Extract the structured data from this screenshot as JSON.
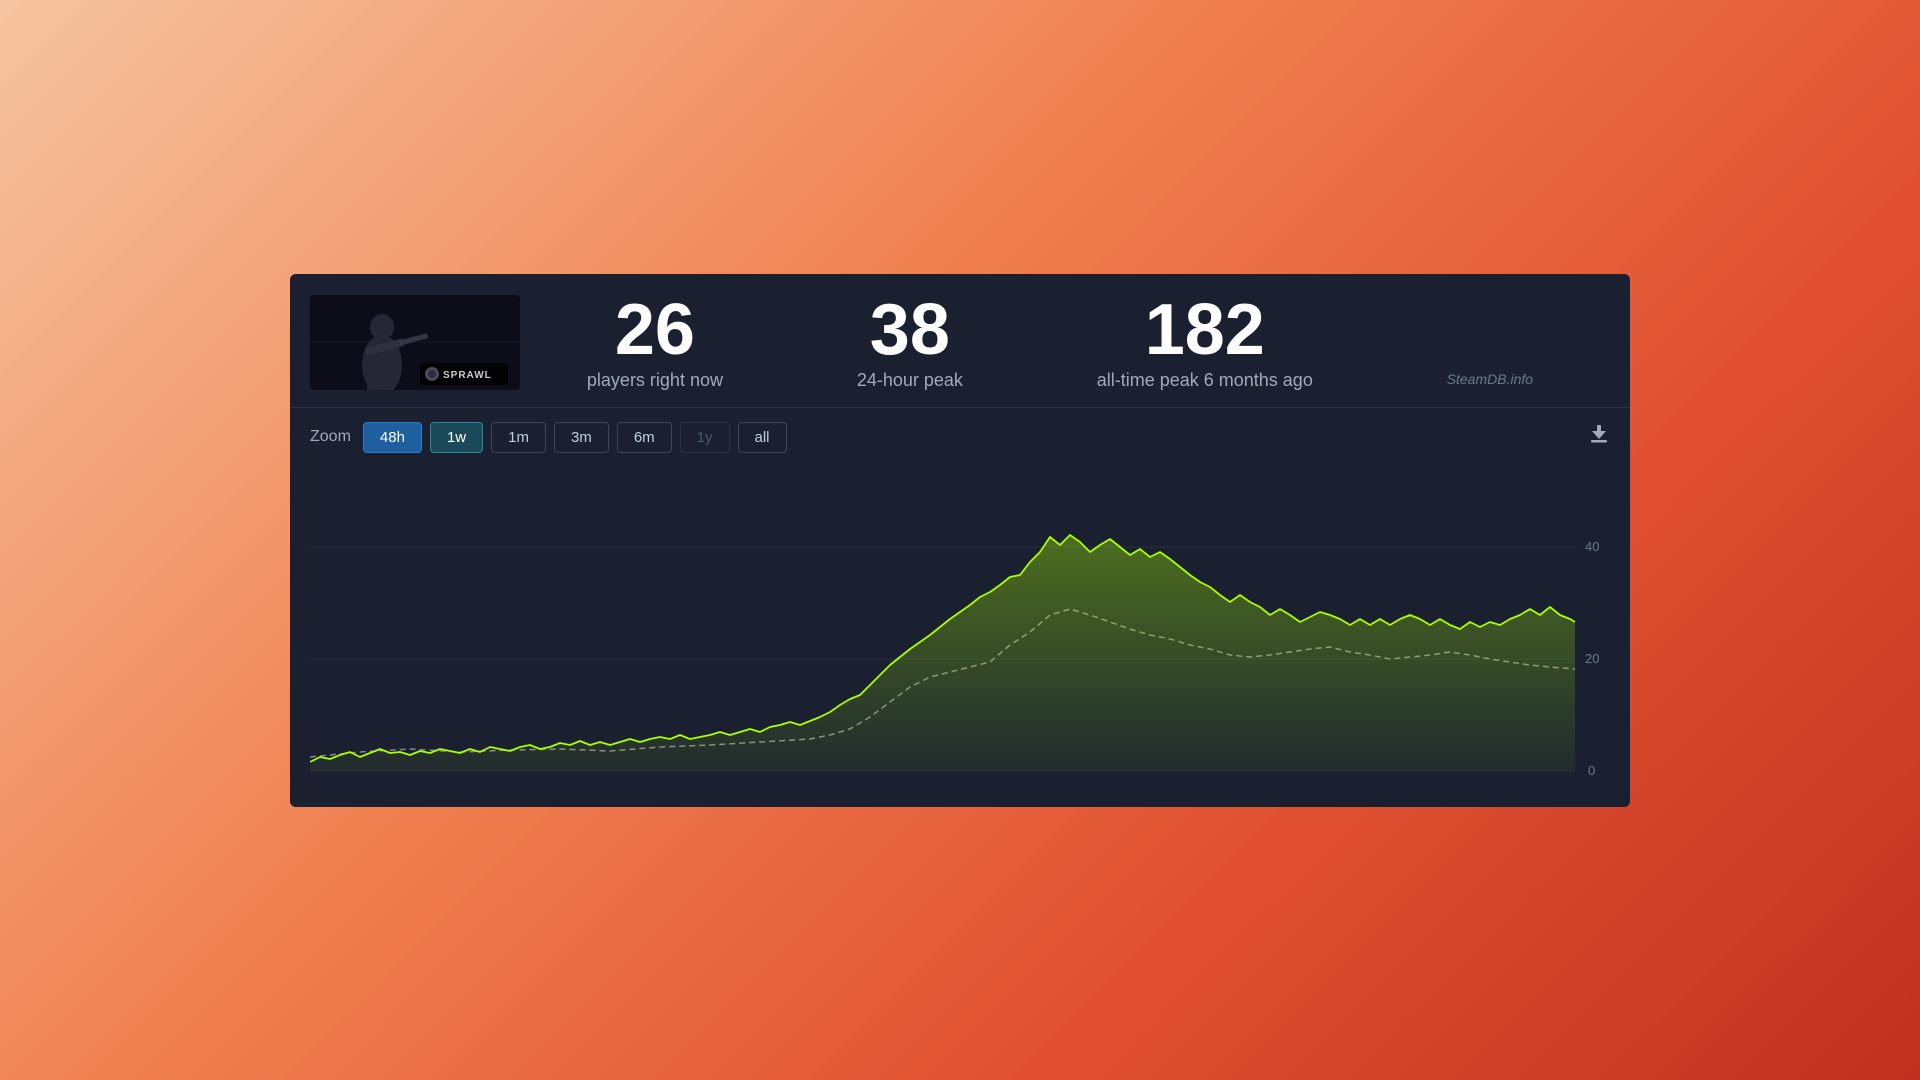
{
  "background": {
    "gradient": "orange-red"
  },
  "card": {
    "game": {
      "name": "SPRAWL",
      "thumbnail_alt": "SPRAWL game thumbnail"
    },
    "stats": {
      "current_players": {
        "number": "26",
        "label": "players right now"
      },
      "peak_24h": {
        "number": "38",
        "label": "24-hour peak"
      },
      "all_time_peak": {
        "number": "182",
        "label": "all-time peak 6 months ago"
      }
    },
    "credit": "SteamDB.info",
    "zoom": {
      "label": "Zoom",
      "buttons": [
        {
          "id": "48h",
          "label": "48h",
          "state": "active-blue"
        },
        {
          "id": "1w",
          "label": "1w",
          "state": "active-teal"
        },
        {
          "id": "1m",
          "label": "1m",
          "state": "normal"
        },
        {
          "id": "3m",
          "label": "3m",
          "state": "normal"
        },
        {
          "id": "6m",
          "label": "6m",
          "state": "normal"
        },
        {
          "id": "1y",
          "label": "1y",
          "state": "disabled"
        },
        {
          "id": "all",
          "label": "all",
          "state": "normal"
        }
      ]
    },
    "chart": {
      "y_labels": [
        "40",
        "20",
        "0"
      ],
      "line_color": "#aaff00",
      "avg_line_color": "#888888"
    }
  }
}
